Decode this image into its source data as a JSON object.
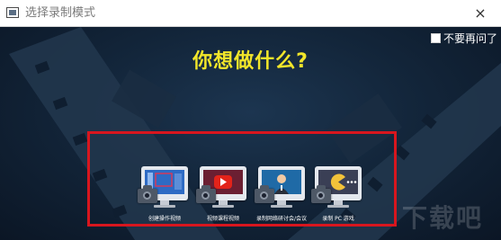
{
  "window": {
    "title": "选择录制模式",
    "close_icon": "×"
  },
  "dont_ask": {
    "label": "不要再问了",
    "checked": false
  },
  "question": "你想做什么?",
  "options": [
    {
      "label": "创建操作视频",
      "icon": "desktop-screen-icon"
    },
    {
      "label": "视频课程视频",
      "icon": "youtube-play-icon"
    },
    {
      "label": "录制网络研讨会/会议",
      "icon": "webinar-person-icon"
    },
    {
      "label": "录制 PC 游戏",
      "icon": "pacman-game-icon"
    }
  ],
  "watermark": "下载吧",
  "colors": {
    "question": "#f2e62a",
    "highlight_border": "#d8161e",
    "background": "#13263b"
  }
}
